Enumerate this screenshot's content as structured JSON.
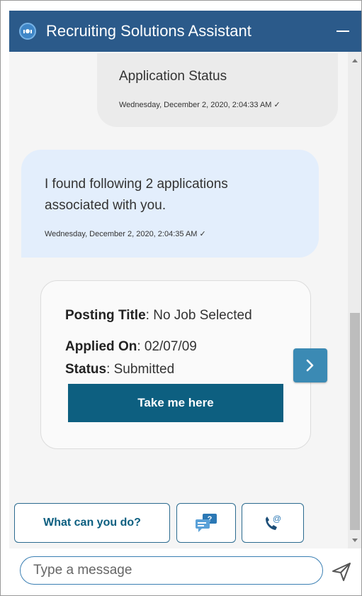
{
  "header": {
    "title": "Recruiting Solutions Assistant",
    "logo_icon": "headset-bot-icon",
    "minimize_icon": "minimize-icon"
  },
  "messages": [
    {
      "sender": "user",
      "text": "Application Status",
      "timestamp": "Wednesday, December 2, 2020, 2:04:33 AM ✓"
    },
    {
      "sender": "bot",
      "text": "I found following 2 applications associated with you.",
      "timestamp": "Wednesday, December 2, 2020, 2:04:35 AM ✓"
    }
  ],
  "card": {
    "posting_title_label": "Posting Title",
    "posting_title_value": ": No Job Selected",
    "applied_on_label": "Applied On",
    "applied_on_value": ": 02/07/09",
    "status_label": "Status",
    "status_value": ": Submitted",
    "action_label": "Take me here"
  },
  "carousel": {
    "next_icon": "chevron-right-icon"
  },
  "quick_replies": [
    {
      "label": "What can you do?"
    },
    {
      "icon": "faq-chat-icon"
    },
    {
      "icon": "phone-email-icon"
    }
  ],
  "composer": {
    "placeholder": "Type a message",
    "send_icon": "send-icon"
  },
  "colors": {
    "header": "#2b5a8a",
    "primary_button": "#0d5f80",
    "bot_bubble": "#e3eefc",
    "user_bubble": "#ebebeb"
  }
}
